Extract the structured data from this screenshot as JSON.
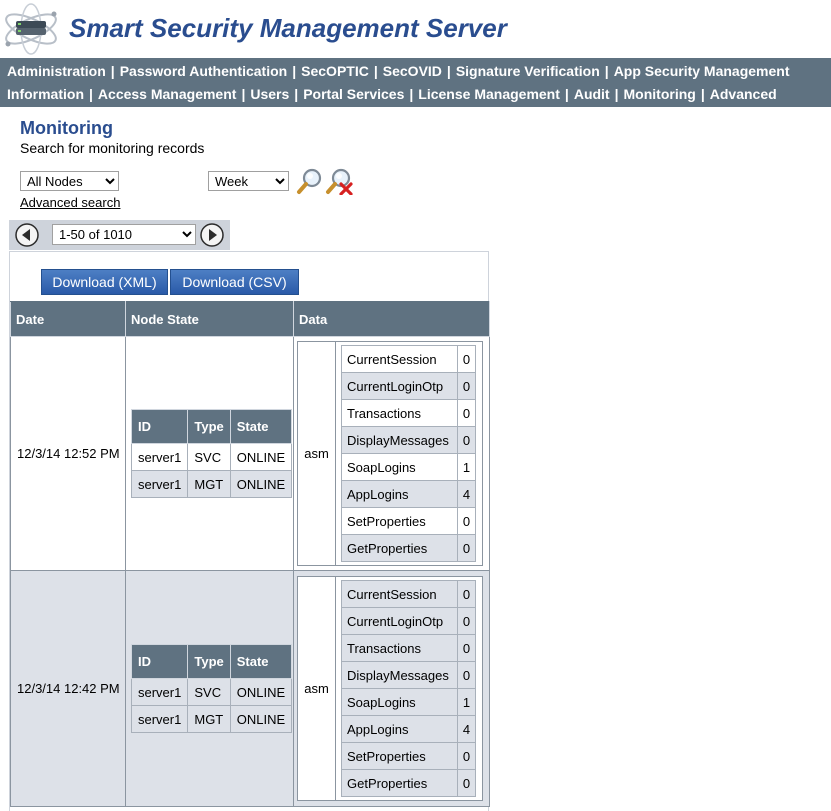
{
  "app": {
    "title": "Smart Security Management Server",
    "logo_icon": "atom-server-logo-icon"
  },
  "nav": {
    "row1": [
      "Administration",
      "Password Authentication",
      "SecOPTIC",
      "SecOVID",
      "Signature Verification",
      "App Security Management"
    ],
    "row2": [
      "Information",
      "Access Management",
      "Users",
      "Portal Services",
      "License Management",
      "Audit",
      "Monitoring",
      "Advanced"
    ],
    "separator": "|",
    "active": "Monitoring"
  },
  "page": {
    "title": "Monitoring",
    "subtitle": "Search for monitoring records"
  },
  "filters": {
    "nodes_selected": "All Nodes",
    "period_selected": "Week",
    "search_icon": "magnifier-icon",
    "clear_icon": "magnifier-clear-icon",
    "advanced_search_label": "Advanced search"
  },
  "pager": {
    "prev_icon": "arrow-left-icon",
    "next_icon": "arrow-right-icon",
    "range_selected": "1-50 of 1010"
  },
  "downloads": {
    "xml_label": "Download (XML)",
    "csv_label": "Download (CSV)"
  },
  "table": {
    "columns": [
      "Date",
      "Node State",
      "Data"
    ],
    "node_columns": [
      "ID",
      "Type",
      "State"
    ],
    "rows": [
      {
        "date": "12/3/14 12:52 PM",
        "nodes": [
          {
            "id": "server1",
            "type": "SVC",
            "state": "ONLINE"
          },
          {
            "id": "server1",
            "type": "MGT",
            "state": "ONLINE"
          }
        ],
        "data_group": "asm",
        "metrics": [
          {
            "name": "CurrentSession",
            "value": "0"
          },
          {
            "name": "CurrentLoginOtp",
            "value": "0"
          },
          {
            "name": "Transactions",
            "value": "0"
          },
          {
            "name": "DisplayMessages",
            "value": "0"
          },
          {
            "name": "SoapLogins",
            "value": "1"
          },
          {
            "name": "AppLogins",
            "value": "4"
          },
          {
            "name": "SetProperties",
            "value": "0"
          },
          {
            "name": "GetProperties",
            "value": "0"
          }
        ]
      },
      {
        "date": "12/3/14 12:42 PM",
        "nodes": [
          {
            "id": "server1",
            "type": "SVC",
            "state": "ONLINE"
          },
          {
            "id": "server1",
            "type": "MGT",
            "state": "ONLINE"
          }
        ],
        "data_group": "asm",
        "metrics": [
          {
            "name": "CurrentSession",
            "value": "0"
          },
          {
            "name": "CurrentLoginOtp",
            "value": "0"
          },
          {
            "name": "Transactions",
            "value": "0"
          },
          {
            "name": "DisplayMessages",
            "value": "0"
          },
          {
            "name": "SoapLogins",
            "value": "1"
          },
          {
            "name": "AppLogins",
            "value": "4"
          },
          {
            "name": "SetProperties",
            "value": "0"
          },
          {
            "name": "GetProperties",
            "value": "0"
          }
        ]
      }
    ]
  }
}
